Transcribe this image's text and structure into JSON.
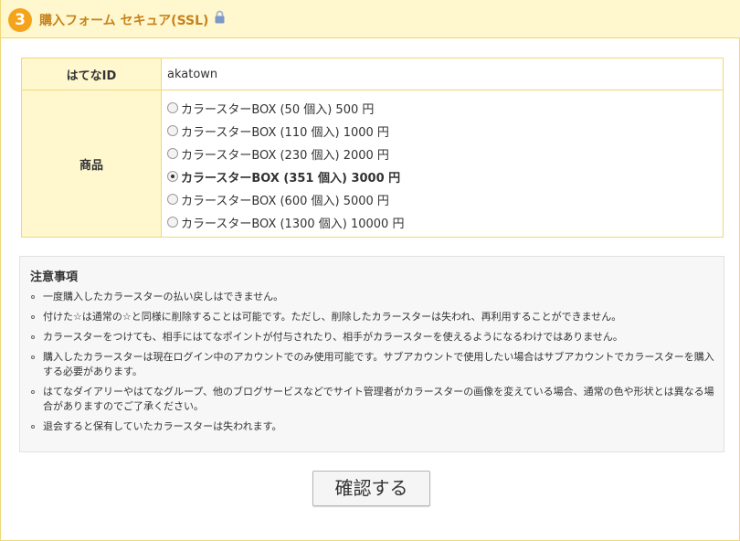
{
  "header": {
    "step_number": "3",
    "title": "購入フォーム セキュア(SSL)",
    "icon": "lock-icon"
  },
  "form": {
    "id_label": "はてなID",
    "id_value": "akatown",
    "items_label": "商品",
    "options": [
      {
        "label": "カラースターBOX (50 個入) 500 円",
        "checked": false
      },
      {
        "label": "カラースターBOX (110 個入) 1000 円",
        "checked": false
      },
      {
        "label": "カラースターBOX (230 個入) 2000 円",
        "checked": false
      },
      {
        "label": "カラースターBOX (351 個入) 3000 円",
        "checked": true
      },
      {
        "label": "カラースターBOX (600 個入) 5000 円",
        "checked": false
      },
      {
        "label": "カラースターBOX (1300 個入) 10000 円",
        "checked": false
      }
    ]
  },
  "notice": {
    "title": "注意事項",
    "items": [
      "一度購入したカラースターの払い戻しはできません。",
      "付けた☆は通常の☆と同様に削除することは可能です。ただし、削除したカラースターは失われ、再利用することができません。",
      "カラースターをつけても、相手にはてなポイントが付与されたり、相手がカラースターを使えるようになるわけではありません。",
      "購入したカラースターは現在ログイン中のアカウントでのみ使用可能です。サブアカウントで使用したい場合はサブアカウントでカラースターを購入する必要があります。",
      "はてなダイアリーやはてなグループ、他のブログサービスなどでサイト管理者がカラースターの画像を変えている場合、通常の色や形状とは異なる場合がありますのでご了承ください。",
      "退会すると保有していたカラースターは失われます。"
    ]
  },
  "confirm_button": "確認する",
  "colors": {
    "header_bg": "#fff8cf",
    "border": "#f0d779",
    "accent": "#f5a31b",
    "title": "#c7821a"
  }
}
